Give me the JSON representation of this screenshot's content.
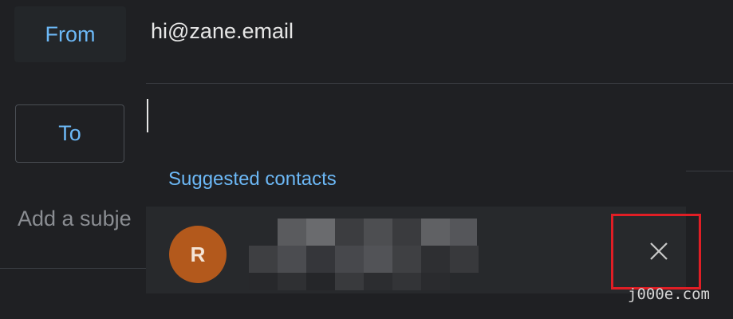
{
  "compose": {
    "from_label": "From",
    "from_value": "hi@zane.email",
    "to_label": "To",
    "subject_placeholder": "Add a subje"
  },
  "suggestions": {
    "title": "Suggested contacts",
    "contacts": [
      {
        "initial": "R",
        "avatar_color": "#b3591c",
        "details_redacted": true
      }
    ],
    "remove_icon": "close-icon"
  },
  "colors": {
    "background": "#1f2023",
    "accent": "#6cb8f6",
    "highlight": "#e01e25"
  },
  "watermark": "j000e.com"
}
